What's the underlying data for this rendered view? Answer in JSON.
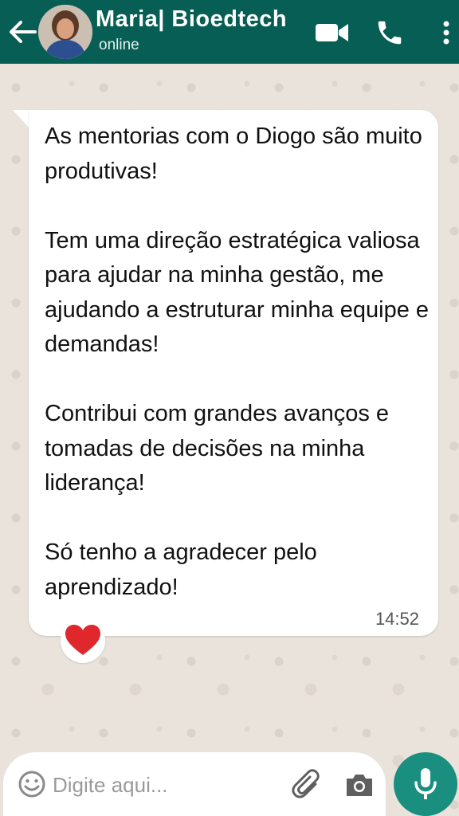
{
  "header": {
    "contact_name": "Maria| Bioedtech",
    "status": "online",
    "back_icon": "arrow-left-icon",
    "video_icon": "video-camera-icon",
    "call_icon": "phone-icon",
    "menu_icon": "more-vertical-icon",
    "background_color": "#075e54"
  },
  "message": {
    "paragraphs": [
      "As mentorias com o Diogo são muito produtivas!",
      "Tem uma direção estratégica valiosa para ajudar na minha gestão, me ajudando a estruturar minha equipe e demandas!",
      "Contribui com grandes avanços e tomadas de decisões na minha liderança!",
      "Só tenho a agradecer pelo aprendizado!"
    ],
    "time": "14:52",
    "reaction_icon": "red-heart-icon",
    "reaction_color": "#e0282c"
  },
  "input_bar": {
    "placeholder": "Digite aqui...",
    "value": "",
    "emoji_icon": "smiley-icon",
    "attach_icon": "paperclip-icon",
    "camera_icon": "camera-icon",
    "mic_icon": "microphone-icon",
    "mic_button_color": "#1b8f7f"
  }
}
